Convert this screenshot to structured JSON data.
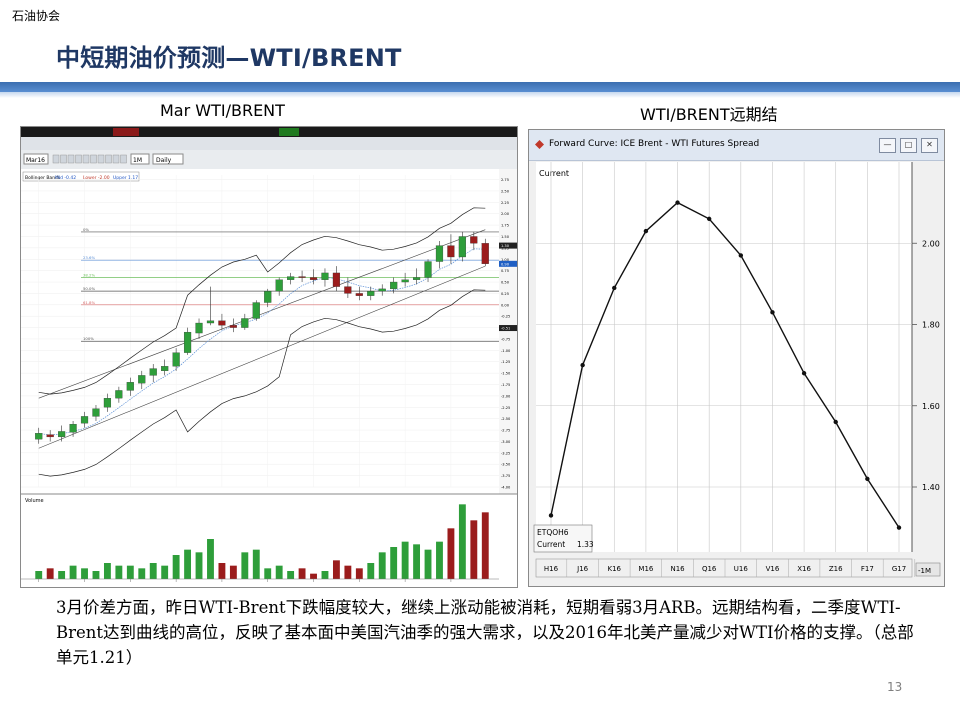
{
  "header": {
    "org": "石油协会",
    "title": "中短期油价预测—WTI/BRENT"
  },
  "captions": {
    "left": "Mar WTI/BRENT",
    "right": "WTI/BRENT远期结"
  },
  "left_chart": {
    "toolbar_symbol": "Mar16",
    "toolbar_interval": "Daily",
    "toolbar_period": "1M",
    "indicator": "Bollinger Bands",
    "indicator_mid": "Mid -0.42",
    "indicator_lower": "Lower -2.00",
    "indicator_upper": "Upper 1.17",
    "volume_label": "Volume",
    "fib_labels": [
      "0%",
      "23.6%",
      "38.2%",
      "50.0%",
      "61.8%",
      "100%"
    ]
  },
  "right_chart": {
    "window_title": "Forward Curve: ICE Brent - WTI Futures Spread",
    "label_current": "Current",
    "box_symbol": "ETQOH6",
    "box_current_label": "Current",
    "box_current_value": "1.33",
    "button": "-1M"
  },
  "body_text": "3月价差方面，昨日WTI-Brent下跌幅度较大，继续上涨动能被消耗，短期看弱3月ARB。远期结构看，二季度WTI-Brent达到曲线的高位，反映了基本面中美国汽油季的强大需求，以及2016年北美产量减少对WTI价格的支撑。（总部单元1.21）",
  "page_number": "13",
  "chart_data": [
    {
      "type": "line",
      "title": "Forward Curve: ICE Brent - WTI Futures Spread",
      "series": [
        {
          "name": "Current",
          "values": [
            1.33,
            1.7,
            1.89,
            2.03,
            2.1,
            2.06,
            1.97,
            1.83,
            1.68,
            1.56,
            1.42,
            1.3
          ]
        }
      ],
      "categories": [
        "H16",
        "J16",
        "K16",
        "M16",
        "N16",
        "Q16",
        "U16",
        "V16",
        "X16",
        "Z16",
        "F17",
        "G17"
      ],
      "yticks": [
        1.4,
        1.6,
        1.8,
        2.0
      ],
      "ylim": [
        1.24,
        2.2
      ],
      "grid": true
    },
    {
      "type": "candlestick",
      "title": "Mar WTI/BRENT",
      "ohlc": [
        [
          -2.95,
          -2.7,
          -3.05,
          -2.82
        ],
        [
          -2.85,
          -2.75,
          -3.0,
          -2.9
        ],
        [
          -2.9,
          -2.65,
          -3.0,
          -2.78
        ],
        [
          -2.8,
          -2.55,
          -2.9,
          -2.62
        ],
        [
          -2.6,
          -2.35,
          -2.7,
          -2.45
        ],
        [
          -2.45,
          -2.2,
          -2.55,
          -2.28
        ],
        [
          -2.25,
          -1.95,
          -2.35,
          -2.05
        ],
        [
          -2.05,
          -1.8,
          -2.15,
          -1.88
        ],
        [
          -1.88,
          -1.6,
          -2.0,
          -1.7
        ],
        [
          -1.72,
          -1.45,
          -1.85,
          -1.55
        ],
        [
          -1.55,
          -1.3,
          -1.7,
          -1.4
        ],
        [
          -1.45,
          -1.2,
          -1.55,
          -1.35
        ],
        [
          -1.35,
          -0.95,
          -1.45,
          -1.05
        ],
        [
          -1.05,
          -0.5,
          -1.1,
          -0.6
        ],
        [
          -0.62,
          -0.3,
          -0.75,
          -0.4
        ],
        [
          -0.4,
          0.4,
          -0.45,
          -0.35
        ],
        [
          -0.35,
          -0.2,
          -0.55,
          -0.45
        ],
        [
          -0.45,
          -0.3,
          -0.6,
          -0.5
        ],
        [
          -0.5,
          -0.2,
          -0.55,
          -0.3
        ],
        [
          -0.3,
          0.1,
          -0.35,
          0.05
        ],
        [
          0.05,
          0.35,
          -0.05,
          0.3
        ],
        [
          0.3,
          0.6,
          0.2,
          0.55
        ],
        [
          0.55,
          0.7,
          0.45,
          0.62
        ],
        [
          0.62,
          0.75,
          0.5,
          0.6
        ],
        [
          0.6,
          0.78,
          0.45,
          0.55
        ],
        [
          0.55,
          0.8,
          0.4,
          0.7
        ],
        [
          0.7,
          0.85,
          0.3,
          0.4
        ],
        [
          0.4,
          0.6,
          0.15,
          0.25
        ],
        [
          0.25,
          0.4,
          0.1,
          0.2
        ],
        [
          0.2,
          0.4,
          0.1,
          0.3
        ],
        [
          0.3,
          0.45,
          0.2,
          0.35
        ],
        [
          0.35,
          0.6,
          0.25,
          0.5
        ],
        [
          0.5,
          0.7,
          0.4,
          0.55
        ],
        [
          0.55,
          0.8,
          0.45,
          0.6
        ],
        [
          0.6,
          1.0,
          0.5,
          0.95
        ],
        [
          0.95,
          1.4,
          0.8,
          1.3
        ],
        [
          1.3,
          1.55,
          0.9,
          1.05
        ],
        [
          1.05,
          1.6,
          0.95,
          1.5
        ],
        [
          1.5,
          1.6,
          1.2,
          1.35
        ],
        [
          1.35,
          1.45,
          0.85,
          0.9
        ]
      ],
      "volume": [
        3,
        4,
        3,
        5,
        4,
        3,
        6,
        5,
        5,
        4,
        6,
        5,
        9,
        11,
        10,
        15,
        6,
        5,
        10,
        11,
        4,
        5,
        3,
        4,
        2,
        3,
        7,
        5,
        4,
        6,
        10,
        12,
        14,
        13,
        11,
        14,
        19,
        28,
        22,
        25
      ],
      "yticks": [
        2.75,
        2.5,
        2.25,
        2.0,
        1.75,
        1.5,
        1.25,
        1.0,
        0.75,
        0.5,
        0.25,
        0.0,
        -0.25,
        -0.5,
        -0.75,
        -1.0,
        -1.25,
        -1.5,
        -1.75,
        -2.0,
        -2.25,
        -2.5,
        -2.75,
        -3.0,
        -3.25,
        -3.5,
        -3.75,
        -4.0
      ],
      "ylim": [
        -4.0,
        2.85
      ],
      "last_values": [
        "1.30",
        "0.90",
        "-0.51"
      ]
    }
  ]
}
